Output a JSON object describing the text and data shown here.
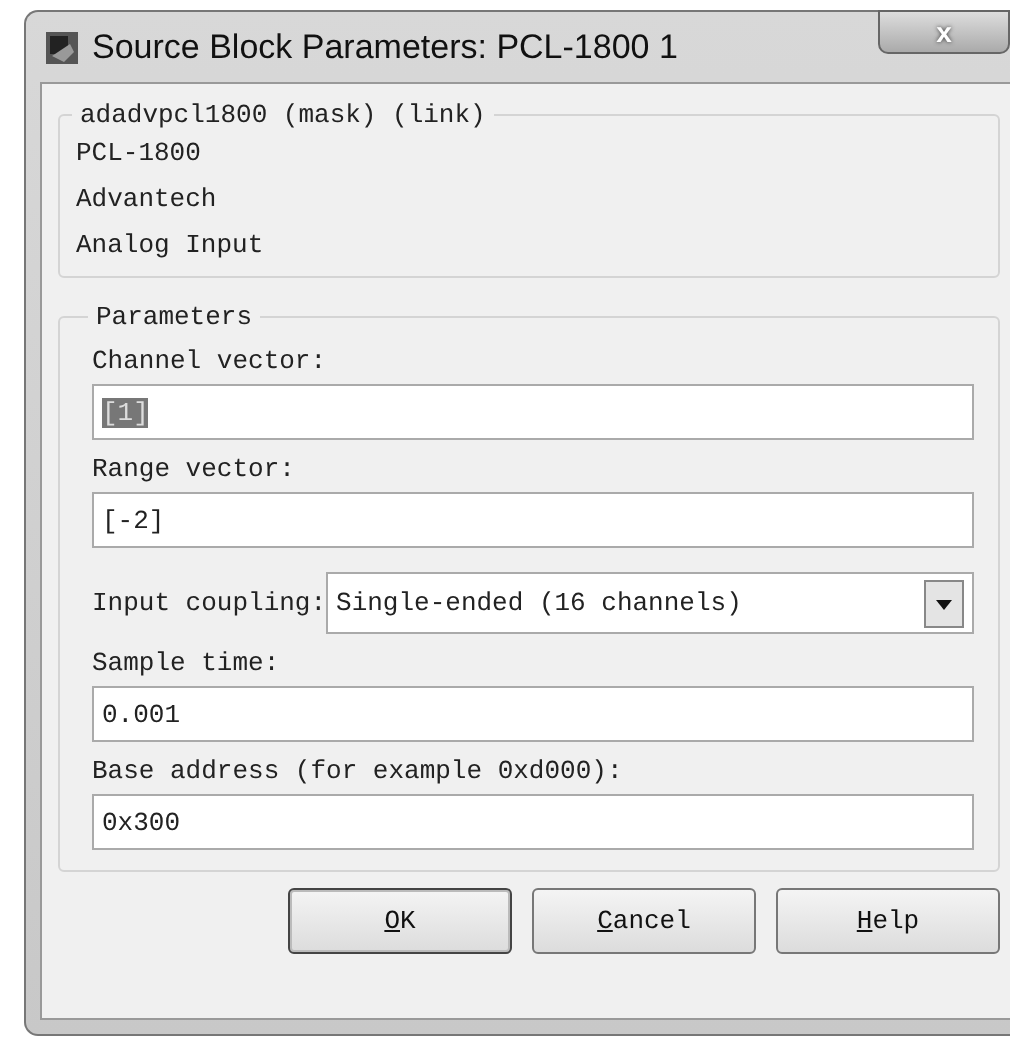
{
  "window": {
    "title": "Source Block Parameters: PCL-1800 1",
    "close": "x"
  },
  "description": {
    "legend": "adadvpcl1800 (mask) (link)",
    "lines": [
      "PCL-1800",
      "Advantech",
      "Analog Input"
    ]
  },
  "parameters": {
    "legend": "Parameters",
    "fields": [
      {
        "kind": "text",
        "label": "Channel vector:",
        "value": "[1]",
        "text_selected": true
      },
      {
        "kind": "text",
        "label": "Range vector:",
        "value": "[-2]",
        "text_selected": false
      },
      {
        "kind": "dropdown",
        "label": "Input coupling:",
        "value": "Single-ended (16 channels)"
      },
      {
        "kind": "text",
        "label": "Sample time:",
        "value": "0.001",
        "text_selected": false
      },
      {
        "kind": "text",
        "label": "Base address (for example 0xd000):",
        "value": "0x300",
        "text_selected": false
      }
    ]
  },
  "buttons": [
    {
      "key": "O",
      "rest": "K",
      "default": true
    },
    {
      "key": "C",
      "rest": "ancel",
      "default": false
    },
    {
      "key": "H",
      "rest": "elp",
      "default": false
    }
  ]
}
